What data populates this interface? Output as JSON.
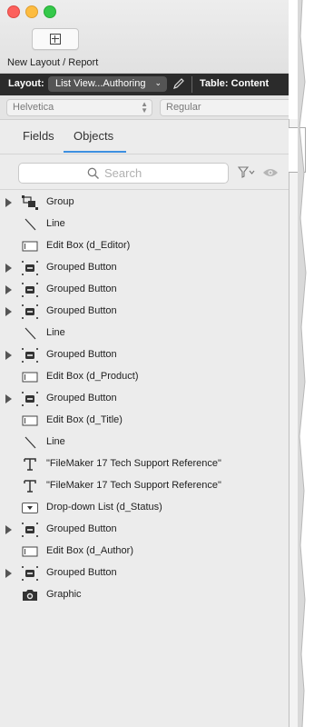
{
  "window": {
    "new_layout_label": "New Layout / Report"
  },
  "layout_bar": {
    "layout_label": "Layout:",
    "layout_value": "List View...Authoring",
    "table_label": "Table: Content"
  },
  "font_bar": {
    "font": "Helvetica",
    "style": "Regular"
  },
  "tabs": [
    {
      "label": "Fields",
      "active": false
    },
    {
      "label": "Objects",
      "active": true
    }
  ],
  "search": {
    "placeholder": "Search",
    "value": ""
  },
  "objects": [
    {
      "label": "Group",
      "type": "group",
      "expandable": true
    },
    {
      "label": "Line",
      "type": "line",
      "expandable": false
    },
    {
      "label": "Edit Box (d_Editor)",
      "type": "editbox",
      "expandable": false
    },
    {
      "label": "Grouped Button",
      "type": "grouped-button",
      "expandable": true
    },
    {
      "label": "Grouped Button",
      "type": "grouped-button",
      "expandable": true
    },
    {
      "label": "Grouped Button",
      "type": "grouped-button",
      "expandable": true
    },
    {
      "label": "Line",
      "type": "line",
      "expandable": false
    },
    {
      "label": "Grouped Button",
      "type": "grouped-button",
      "expandable": true
    },
    {
      "label": "Edit Box (d_Product)",
      "type": "editbox",
      "expandable": false
    },
    {
      "label": "Grouped Button",
      "type": "grouped-button",
      "expandable": true
    },
    {
      "label": "Edit Box (d_Title)",
      "type": "editbox",
      "expandable": false
    },
    {
      "label": "Line",
      "type": "line",
      "expandable": false
    },
    {
      "label": "\"FileMaker 17 Tech Support Reference\"",
      "type": "text",
      "expandable": false
    },
    {
      "label": "\"FileMaker 17 Tech Support Reference\"",
      "type": "text",
      "expandable": false
    },
    {
      "label": "Drop-down List (d_Status)",
      "type": "dropdown",
      "expandable": false
    },
    {
      "label": "Grouped Button",
      "type": "grouped-button",
      "expandable": true
    },
    {
      "label": "Edit Box (d_Author)",
      "type": "editbox",
      "expandable": false
    },
    {
      "label": "Grouped Button",
      "type": "grouped-button",
      "expandable": true
    },
    {
      "label": "Graphic",
      "type": "graphic",
      "expandable": false
    }
  ],
  "colors": {
    "accent": "#3d8fe0",
    "layout_bar": "#2b2b2b"
  }
}
